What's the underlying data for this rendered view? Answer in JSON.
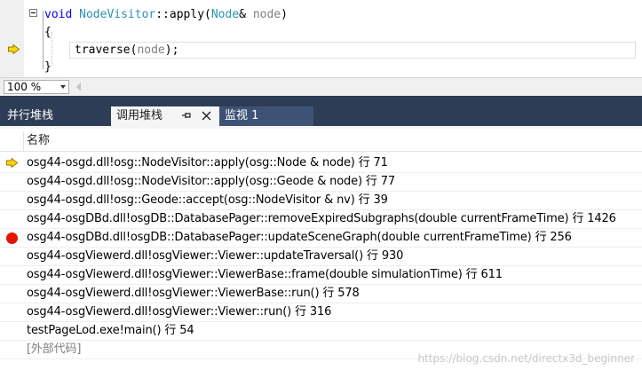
{
  "editor": {
    "lines": {
      "signature_kw": "void",
      "signature_class": "NodeVisitor",
      "signature_rest": "::apply(",
      "signature_type": "Node",
      "signature_amp": "& ",
      "signature_param": "node",
      "signature_close": ")",
      "open_brace": "{",
      "call_name": "traverse(",
      "call_param": "node",
      "call_end": ");",
      "close_brace": "}"
    }
  },
  "zoom": {
    "value": "100 %"
  },
  "tabs": {
    "parallel_stacks": "并行堆栈",
    "call_stack": "调用堆栈",
    "watch": "监视 1"
  },
  "call_stack": {
    "column_name": "名称",
    "rows": [
      {
        "text": "osg44-osgd.dll!osg::NodeVisitor::apply(osg::Node & node) 行 71",
        "marker": "current"
      },
      {
        "text": "osg44-osgd.dll!osg::NodeVisitor::apply(osg::Geode & node) 行 77",
        "marker": ""
      },
      {
        "text": "osg44-osgd.dll!osg::Geode::accept(osg::NodeVisitor & nv) 行 39",
        "marker": ""
      },
      {
        "text": "osg44-osgDBd.dll!osgDB::DatabasePager::removeExpiredSubgraphs(double currentFrameTime) 行 1426",
        "marker": ""
      },
      {
        "text": "osg44-osgDBd.dll!osgDB::DatabasePager::updateSceneGraph(double currentFrameTime) 行 256",
        "marker": "breakpoint"
      },
      {
        "text": "osg44-osgViewerd.dll!osgViewer::Viewer::updateTraversal() 行 930",
        "marker": ""
      },
      {
        "text": "osg44-osgViewerd.dll!osgViewer::ViewerBase::frame(double simulationTime) 行 611",
        "marker": ""
      },
      {
        "text": "osg44-osgViewerd.dll!osgViewer::ViewerBase::run() 行 578",
        "marker": ""
      },
      {
        "text": "osg44-osgViewerd.dll!osgViewer::Viewer::run() 行 316",
        "marker": ""
      },
      {
        "text": "testPageLod.exe!main() 行 54",
        "marker": ""
      },
      {
        "text": "[外部代码]",
        "marker": "external"
      }
    ]
  },
  "watermark": "https://blog.csdn.net/directx3d_beginner",
  "colors": {
    "keyword": "#0000ff",
    "type": "#2b91af",
    "param": "#808080",
    "tab_band": "#2d3d56",
    "breakpoint": "#e51400",
    "exec_arrow": "#ffd800"
  }
}
